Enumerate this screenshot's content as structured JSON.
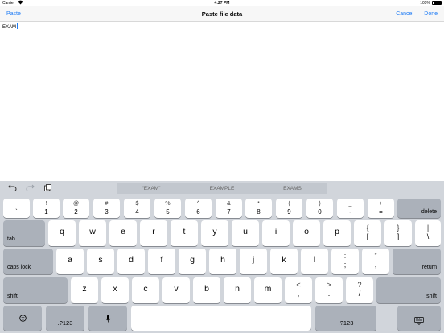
{
  "status_bar": {
    "carrier": "Carrier",
    "wifi": "wifi-icon",
    "time": "4:27 PM",
    "battery": "100%"
  },
  "nav": {
    "left": "Paste",
    "title": "Paste file data",
    "cancel": "Cancel",
    "done": "Done"
  },
  "editor": {
    "text": "EXAM"
  },
  "keyboard": {
    "suggestions": [
      "“EXAM”",
      "EXAMPLE",
      "EXAMS"
    ],
    "row1": [
      {
        "top": "~",
        "bot": "`"
      },
      {
        "top": "!",
        "bot": "1"
      },
      {
        "top": "@",
        "bot": "2"
      },
      {
        "top": "#",
        "bot": "3"
      },
      {
        "top": "$",
        "bot": "4"
      },
      {
        "top": "%",
        "bot": "5"
      },
      {
        "top": "^",
        "bot": "6"
      },
      {
        "top": "&",
        "bot": "7"
      },
      {
        "top": "*",
        "bot": "8"
      },
      {
        "top": "(",
        "bot": "9"
      },
      {
        "top": ")",
        "bot": "0"
      },
      {
        "top": "_",
        "bot": "-"
      },
      {
        "top": "+",
        "bot": "="
      }
    ],
    "delete": "delete",
    "tab": "tab",
    "row2": [
      "q",
      "w",
      "e",
      "r",
      "t",
      "y",
      "u",
      "i",
      "o",
      "p"
    ],
    "row2_sym": [
      {
        "top": "{",
        "bot": "["
      },
      {
        "top": "}",
        "bot": "]"
      },
      {
        "top": "|",
        "bot": "\\"
      }
    ],
    "caps": "caps lock",
    "row3": [
      "a",
      "s",
      "d",
      "f",
      "g",
      "h",
      "j",
      "k",
      "l"
    ],
    "row3_sym": [
      {
        "top": ":",
        "bot": ";"
      },
      {
        "top": "”",
        "bot": ","
      }
    ],
    "return": "return",
    "shift": "shift",
    "row4": [
      "z",
      "x",
      "c",
      "v",
      "b",
      "n",
      "m"
    ],
    "row4_sym": [
      {
        "top": "<",
        "bot": ","
      },
      {
        "top": ">",
        "bot": "."
      },
      {
        "top": "?",
        "bot": "/"
      }
    ],
    "numkey": ".?123",
    "icons": {
      "undo": "undo-icon",
      "redo": "redo-icon",
      "paste": "clipboard-icon",
      "globe": "emoji-icon",
      "mic": "microphone-icon",
      "dismiss": "keyboard-dismiss-icon"
    }
  }
}
